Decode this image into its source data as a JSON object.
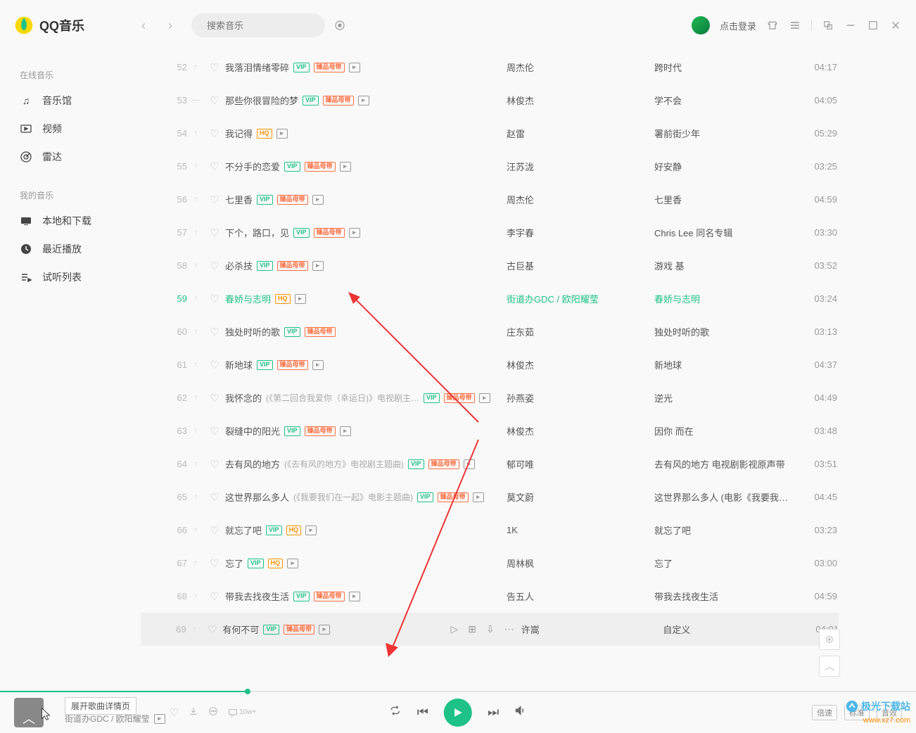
{
  "app": {
    "name": "QQ音乐"
  },
  "search": {
    "placeholder": "搜索音乐"
  },
  "header": {
    "login": "点击登录"
  },
  "sidebar": {
    "section1": "在线音乐",
    "items1": [
      "音乐馆",
      "视频",
      "雷达"
    ],
    "section2": "我的音乐",
    "items2": [
      "本地和下载",
      "最近播放",
      "试听列表"
    ]
  },
  "badges": {
    "vip": "VIP",
    "master": "臻品母带",
    "hq": "HQ"
  },
  "songs": [
    {
      "num": "52",
      "title": "我落泪情绪零碎",
      "artist": "周杰伦",
      "album": "跨时代",
      "dur": "04:17",
      "vip": true,
      "master": true,
      "mv": true
    },
    {
      "num": "53",
      "trend": "—",
      "title": "那些你很冒险的梦",
      "artist": "林俊杰",
      "album": "学不会",
      "dur": "04:05",
      "vip": true,
      "master": true,
      "mv": true
    },
    {
      "num": "54",
      "title": "我记得",
      "artist": "赵雷",
      "album": "署前街少年",
      "dur": "05:29",
      "hq": true,
      "mv": true
    },
    {
      "num": "55",
      "title": "不分手的恋爱",
      "artist": "汪苏泷",
      "album": "好安静",
      "dur": "03:25",
      "vip": true,
      "master": true,
      "mv": true
    },
    {
      "num": "56",
      "title": "七里香",
      "artist": "周杰伦",
      "album": "七里香",
      "dur": "04:59",
      "vip": true,
      "master": true,
      "mv": true
    },
    {
      "num": "57",
      "title": "下个，路口，见",
      "artist": "李宇春",
      "album": "Chris Lee 同名专辑",
      "dur": "03:30",
      "vip": true,
      "master": true,
      "mv": true
    },
    {
      "num": "58",
      "title": "必杀技",
      "artist": "古巨基",
      "album": "游戏 基",
      "dur": "03:52",
      "vip": true,
      "master": true,
      "mv": true
    },
    {
      "num": "59",
      "title": "春娇与志明",
      "artist": "街道办GDC / 欧阳耀莹",
      "album": "春娇与志明",
      "dur": "03:24",
      "hq": true,
      "mv": true,
      "active": true
    },
    {
      "num": "60",
      "title": "独处时听的歌",
      "artist": "庄东茹",
      "album": "独处时听的歌",
      "dur": "03:13",
      "vip": true,
      "master": true
    },
    {
      "num": "61",
      "title": "新地球",
      "artist": "林俊杰",
      "album": "新地球",
      "dur": "04:37",
      "vip": true,
      "master": true,
      "mv": true
    },
    {
      "num": "62",
      "title": "我怀念的",
      "subtitle": "(《第二回合我爱你（幸运日)》电视剧主…",
      "artist": "孙燕姿",
      "album": "逆光",
      "dur": "04:49",
      "vip": true,
      "master": true,
      "mv": true
    },
    {
      "num": "63",
      "title": "裂缝中的阳光",
      "artist": "林俊杰",
      "album": "因你 而在",
      "dur": "03:48",
      "vip": true,
      "master": true,
      "mv": true
    },
    {
      "num": "64",
      "title": "去有风的地方",
      "subtitle": "(《去有风的地方》电视剧主题曲)",
      "artist": "郁可唯",
      "album": "去有风的地方 电视剧影视原声带",
      "dur": "03:51",
      "vip": true,
      "master": true,
      "mv": true
    },
    {
      "num": "65",
      "title": "这世界那么多人",
      "subtitle": "(《我要我们在一起》电影主题曲)",
      "artist": "莫文蔚",
      "album": "这世界那么多人 (电影《我要我们…",
      "dur": "04:45",
      "vip": true,
      "master": true,
      "mv": true
    },
    {
      "num": "66",
      "title": "就忘了吧",
      "artist": "1K",
      "album": "就忘了吧",
      "dur": "03:23",
      "vip": true,
      "hq": true,
      "mv": true
    },
    {
      "num": "67",
      "title": "忘了",
      "artist": "周林枫",
      "album": "忘了",
      "dur": "03:00",
      "vip": true,
      "hq": true,
      "mv": true
    },
    {
      "num": "68",
      "title": "带我去找夜生活",
      "artist": "告五人",
      "album": "带我去找夜生活",
      "dur": "04:59",
      "vip": true,
      "master": true,
      "mv": true
    },
    {
      "num": "69",
      "title": "有何不可",
      "artist": "许嵩",
      "album": "自定义",
      "dur": "04:01",
      "vip": true,
      "master": true,
      "mv": true,
      "hovered": true
    }
  ],
  "player": {
    "tooltip": "展开歌曲详情页",
    "artist": "街道办GDC / 欧阳耀莹",
    "plays": "10w+",
    "pills": [
      "倍速",
      "标准",
      "音效"
    ]
  },
  "watermark": {
    "name": "极光下载站",
    "url": "www.xz7.com"
  }
}
